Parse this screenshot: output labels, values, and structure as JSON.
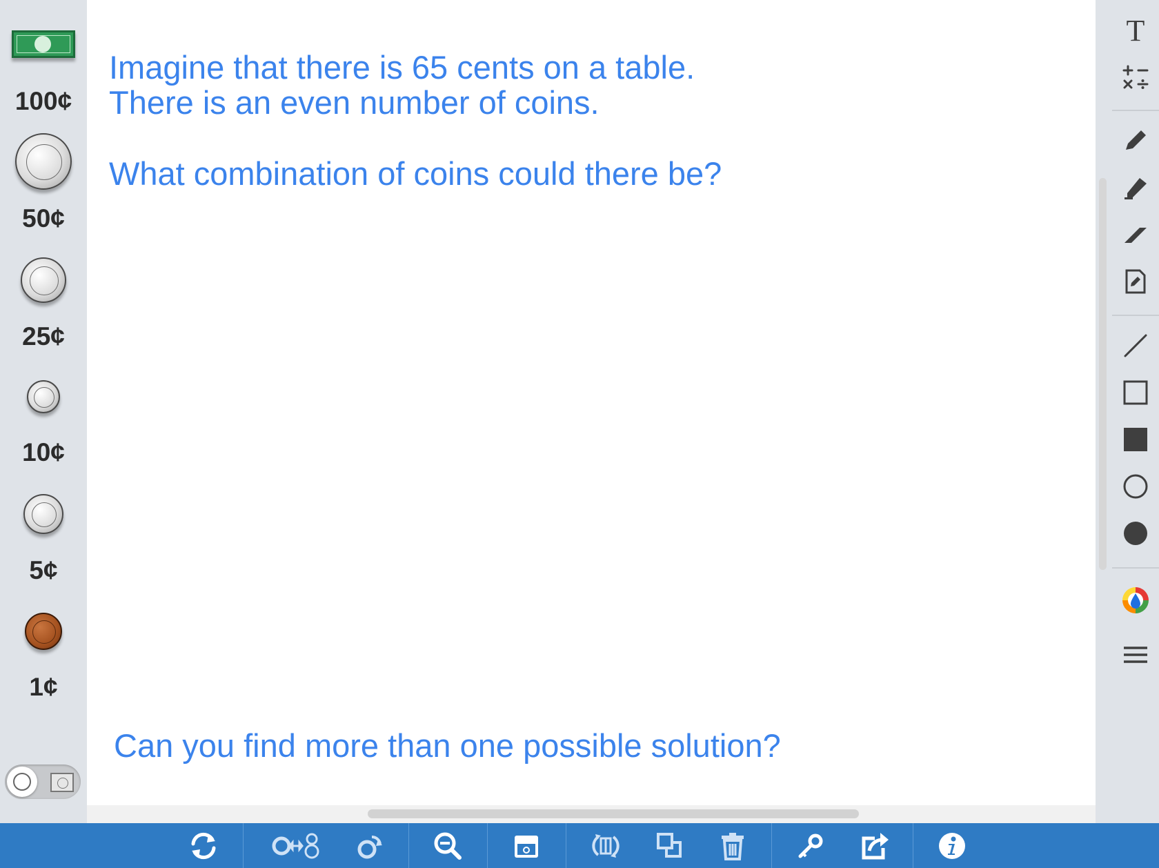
{
  "canvas": {
    "prompt_line1": "Imagine that there is 65 cents on a table.",
    "prompt_line2": "There is an even number of coins.",
    "question": "What combination of coins could there be?",
    "footer_question": "Can you find more than one possible solution?"
  },
  "money_panel": {
    "items": [
      {
        "label": "100¢",
        "icon": "dollar-bill-icon"
      },
      {
        "label": "50¢",
        "icon": "half-dollar-icon"
      },
      {
        "label": "25¢",
        "icon": "quarter-icon"
      },
      {
        "label": "10¢",
        "icon": "dime-icon"
      },
      {
        "label": "5¢",
        "icon": "nickel-icon"
      },
      {
        "label": "1¢",
        "icon": "penny-icon"
      }
    ],
    "toggle": {
      "icons": [
        "coin-icon",
        "bill-icon"
      ]
    }
  },
  "right_toolbar": {
    "tools": [
      "text-icon",
      "math-symbols-icon",
      "pencil-icon",
      "highlighter-icon",
      "eraser-icon",
      "note-icon",
      "line-icon",
      "rectangle-outline-icon",
      "rectangle-filled-icon",
      "circle-outline-icon",
      "circle-filled-icon",
      "color-picker-icon",
      "menu-icon"
    ]
  },
  "bottom_toolbar": {
    "tools": [
      "reset-icon",
      "exchange-icon",
      "flip-coin-icon",
      "zoom-out-icon",
      "tray-icon",
      "rotate-icon",
      "duplicate-icon",
      "trash-icon",
      "key-icon",
      "share-icon",
      "info-icon"
    ]
  },
  "colors": {
    "prompt_text": "#3b83ec",
    "bottom_bar": "#2f7bc4",
    "panel_bg": "#dfe3e8",
    "canvas_bg": "#ffffff",
    "toolbar_icon": "#3f3f3f"
  }
}
